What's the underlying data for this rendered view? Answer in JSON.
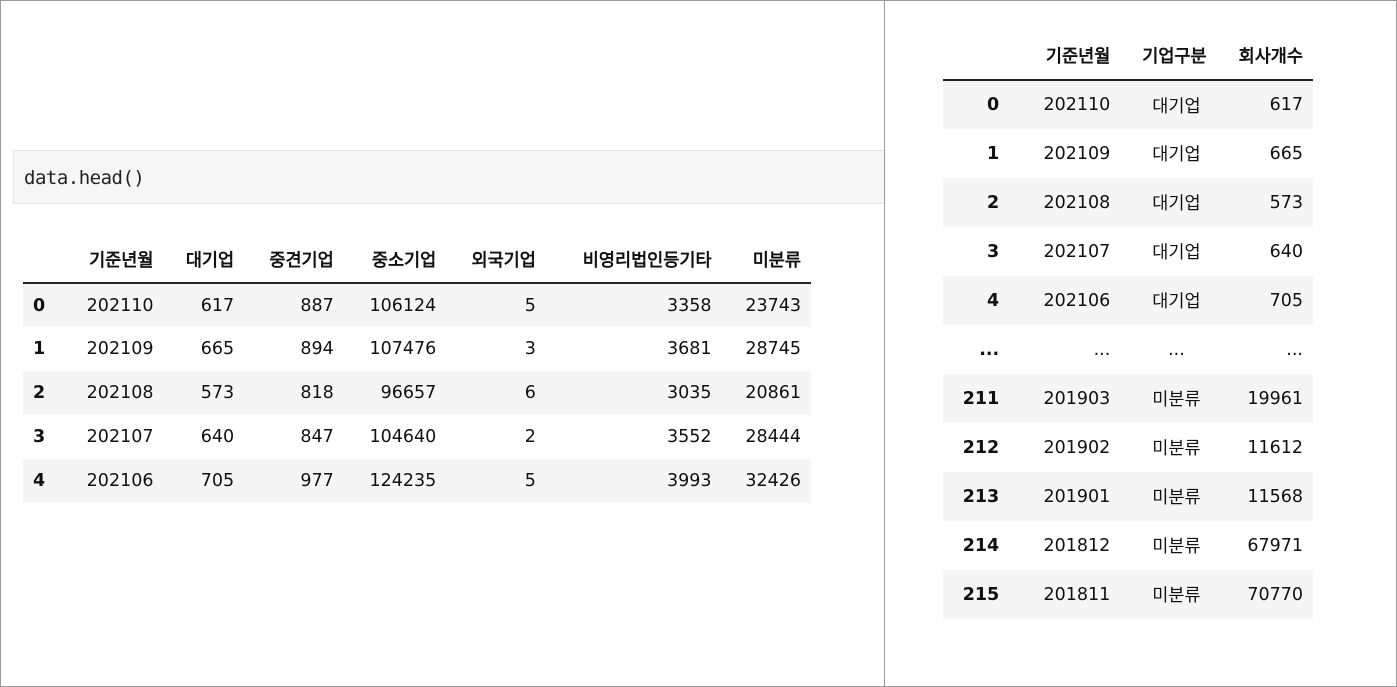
{
  "code_cell": {
    "input": "data.head()"
  },
  "left_table": {
    "columns": [
      "기준년월",
      "대기업",
      "중견기업",
      "중소기업",
      "외국기업",
      "비영리법인등기타",
      "미분류"
    ],
    "rows": [
      {
        "index": "0",
        "cells": [
          "202110",
          "617",
          "887",
          "106124",
          "5",
          "3358",
          "23743"
        ]
      },
      {
        "index": "1",
        "cells": [
          "202109",
          "665",
          "894",
          "107476",
          "3",
          "3681",
          "28745"
        ]
      },
      {
        "index": "2",
        "cells": [
          "202108",
          "573",
          "818",
          "96657",
          "6",
          "3035",
          "20861"
        ]
      },
      {
        "index": "3",
        "cells": [
          "202107",
          "640",
          "847",
          "104640",
          "2",
          "3552",
          "28444"
        ]
      },
      {
        "index": "4",
        "cells": [
          "202106",
          "705",
          "977",
          "124235",
          "5",
          "3993",
          "32426"
        ]
      }
    ]
  },
  "right_table": {
    "columns": [
      "기준년월",
      "기업구분",
      "회사개수"
    ],
    "rows": [
      {
        "index": "0",
        "cells": [
          "202110",
          "대기업",
          "617"
        ]
      },
      {
        "index": "1",
        "cells": [
          "202109",
          "대기업",
          "665"
        ]
      },
      {
        "index": "2",
        "cells": [
          "202108",
          "대기업",
          "573"
        ]
      },
      {
        "index": "3",
        "cells": [
          "202107",
          "대기업",
          "640"
        ]
      },
      {
        "index": "4",
        "cells": [
          "202106",
          "대기업",
          "705"
        ]
      },
      {
        "index": "...",
        "cells": [
          "...",
          "...",
          "..."
        ]
      },
      {
        "index": "211",
        "cells": [
          "201903",
          "미분류",
          "19961"
        ]
      },
      {
        "index": "212",
        "cells": [
          "201902",
          "미분류",
          "11612"
        ]
      },
      {
        "index": "213",
        "cells": [
          "201901",
          "미분류",
          "11568"
        ]
      },
      {
        "index": "214",
        "cells": [
          "201812",
          "미분류",
          "67971"
        ]
      },
      {
        "index": "215",
        "cells": [
          "201811",
          "미분류",
          "70770"
        ]
      }
    ]
  },
  "colors": {
    "stripe": "#f5f5f5",
    "code_background": "#f6f6f6",
    "border": "#9a9a9a"
  }
}
